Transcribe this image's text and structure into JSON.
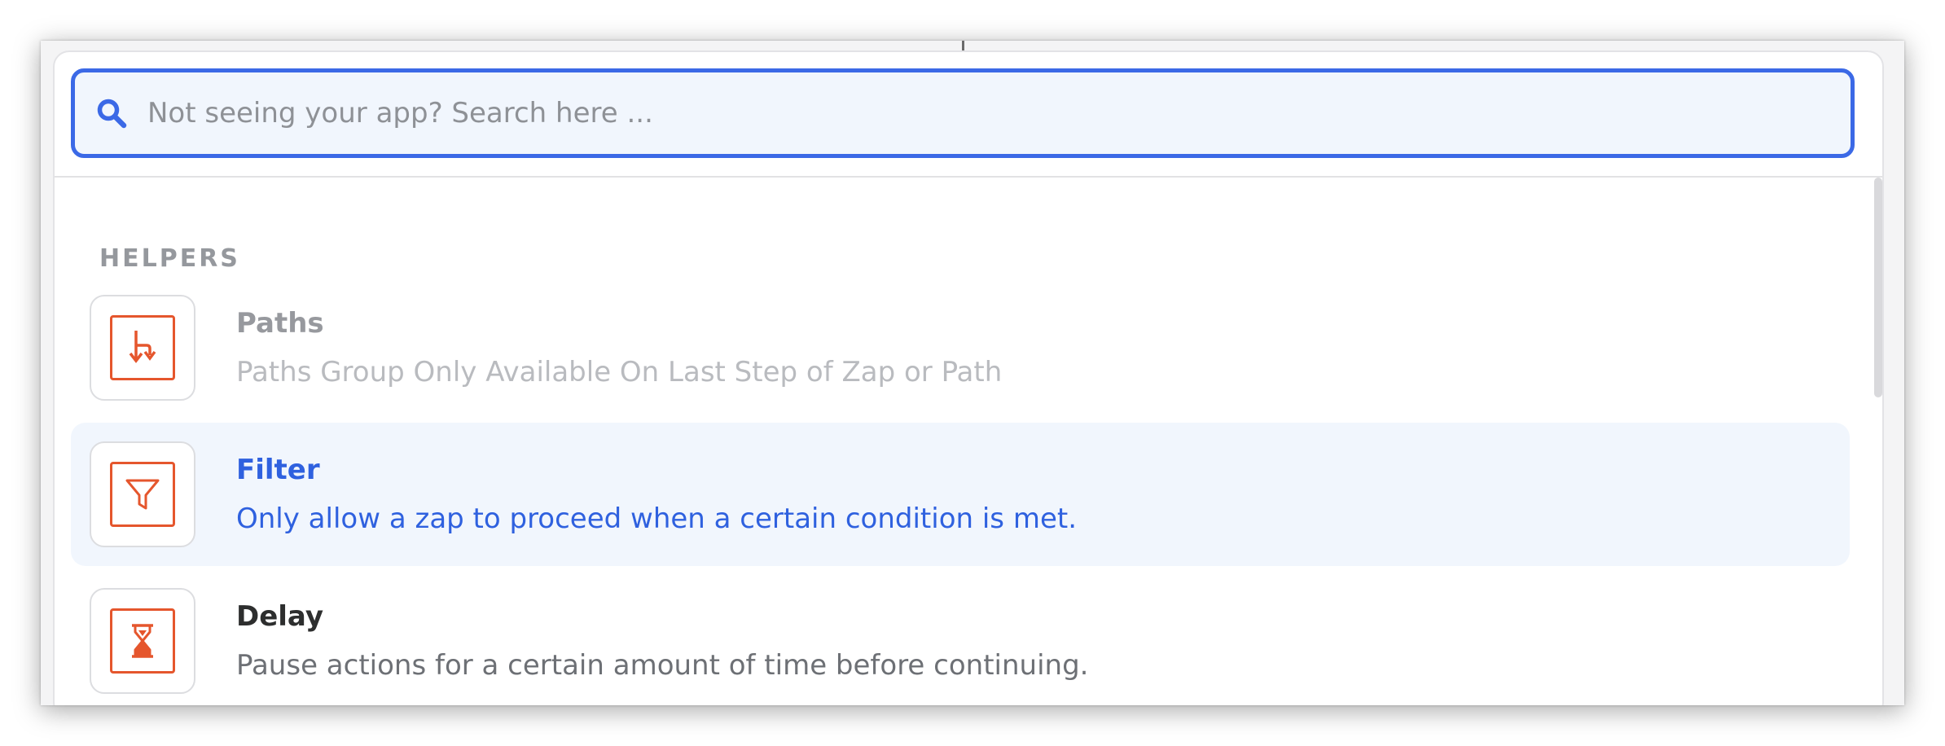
{
  "search": {
    "placeholder": "Not seeing your app? Search here ...",
    "value": ""
  },
  "helpers": {
    "title": "HELPERS",
    "items": [
      {
        "title": "Paths",
        "description": "Paths Group Only Available On Last Step of Zap or Path",
        "icon": "paths-icon",
        "state": "disabled"
      },
      {
        "title": "Filter",
        "description": "Only allow a zap to proceed when a certain condition is met.",
        "icon": "filter-icon",
        "state": "selected"
      },
      {
        "title": "Delay",
        "description": "Pause actions for a certain amount of time before continuing.",
        "icon": "hourglass-icon",
        "state": "normal"
      }
    ]
  },
  "colors": {
    "accent": "#3b69e6",
    "icon_orange": "#e5562d",
    "selected_bg": "#f1f6fd"
  }
}
